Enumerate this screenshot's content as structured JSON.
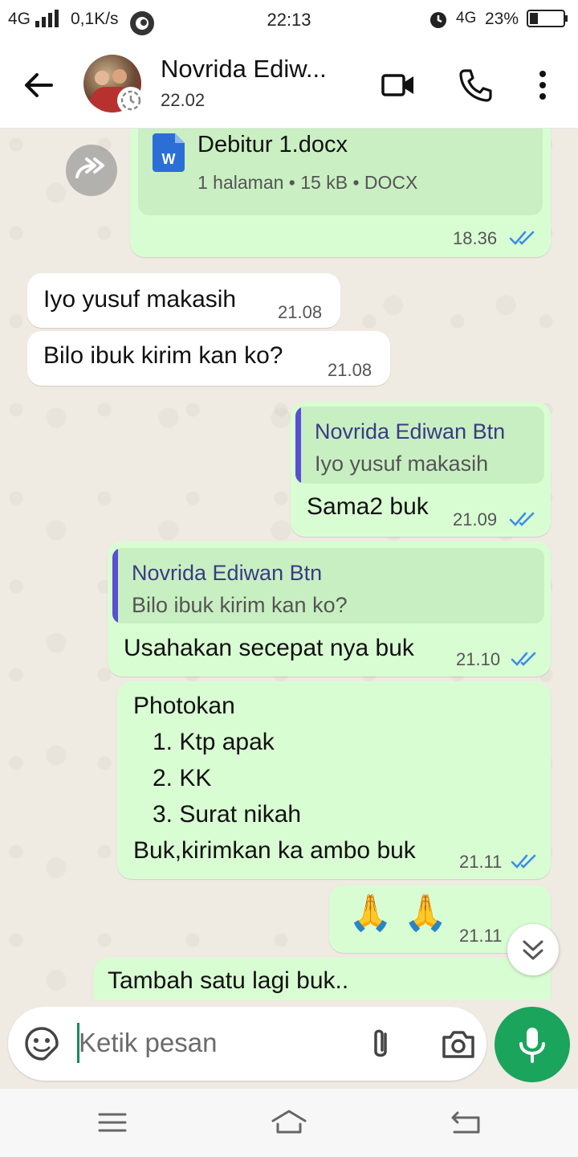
{
  "status_bar": {
    "network": "4G",
    "speed": "0,1K/s",
    "time": "22:13",
    "network_right": "4G",
    "battery": "23%"
  },
  "header": {
    "contact_name": "Novrida Ediw...",
    "contact_status": "22.02"
  },
  "messages": {
    "doc": {
      "file_name": "Debitur 1.docx",
      "meta": "1 halaman • 15 kB • DOCX",
      "time": "18.36",
      "doc_badge": "W"
    },
    "m1": {
      "text": "Iyo yusuf makasih",
      "time": "21.08"
    },
    "m2": {
      "text": "Bilo ibuk kirim kan ko?",
      "time": "21.08"
    },
    "m3": {
      "quote_author": "Novrida Ediwan Btn",
      "quote_text": "Iyo yusuf makasih",
      "text": "Sama2 buk",
      "time": "21.09"
    },
    "m4": {
      "quote_author": "Novrida Ediwan Btn",
      "quote_text": "Bilo ibuk kirim kan ko?",
      "text": "Usahakan secepat nya buk",
      "time": "21.10"
    },
    "m5": {
      "line1": "Photokan",
      "items": [
        "1. Ktp apak",
        "2. KK",
        "3. Surat nikah"
      ],
      "line_last": "Buk,kirimkan ka ambo buk",
      "time": "21.11"
    },
    "m6": {
      "text": "🙏🙏",
      "time": "21.11"
    },
    "m7": {
      "text": "Tambah satu lagi buk.."
    }
  },
  "composer": {
    "placeholder": "Ketik pesan"
  },
  "colors": {
    "outgoing_bubble": "#d9fdd3",
    "incoming_bubble": "#ffffff",
    "read_ticks": "#3d8de6",
    "mic_button": "#1aa45c",
    "quote_bar": "#5a4fd1"
  },
  "icons": [
    "back-arrow-icon",
    "video-call-icon",
    "phone-icon",
    "more-vert-icon",
    "forward-icon",
    "word-doc-icon",
    "double-check-icon",
    "chevron-double-down-icon",
    "sticker-icon",
    "paperclip-icon",
    "camera-icon",
    "mic-icon"
  ]
}
